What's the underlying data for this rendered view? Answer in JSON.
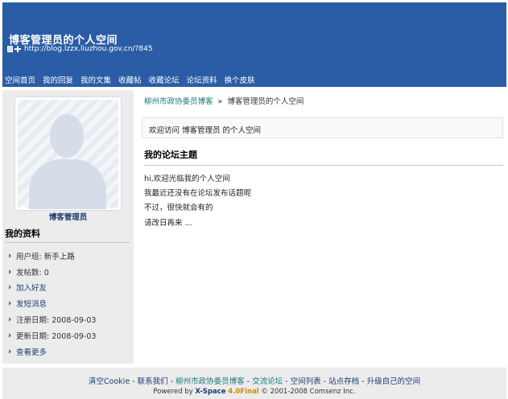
{
  "header": {
    "title": "博客管理员的个人空间",
    "url": "http://blog.lzzx.liuzhou.gov.cn/?845"
  },
  "nav": {
    "items": [
      "空间首页",
      "我的回复",
      "我的文集",
      "收藏帖",
      "收藏论坛",
      "论坛资料",
      "换个皮肤"
    ]
  },
  "sidebar": {
    "name": "博客管理员",
    "heading": "我的资料",
    "items": [
      {
        "label": "用户组: 新手上路"
      },
      {
        "label": "发帖数: 0"
      },
      {
        "label": "加入好友"
      },
      {
        "label": "发短消息"
      },
      {
        "label": "注册日期: 2008-09-03"
      },
      {
        "label": "更新日期: 2008-09-03"
      },
      {
        "label": "查看更多"
      }
    ]
  },
  "main": {
    "breadcrumb_link": "柳州市政协委员博客",
    "breadcrumb_sep": "»",
    "breadcrumb_current": "博客管理员的个人空间",
    "welcome": "欢迎访问 博客管理员 的个人空间",
    "forum_heading": "我的论坛主题",
    "forum_lines": [
      "hi,欢迎光临我的个人空间",
      "我最近还没有在论坛发布话题呢",
      "不过，很快就会有的",
      "请改日再来  ..."
    ]
  },
  "footer": {
    "links": [
      "清空Cookie",
      "联系我们",
      "柳州市政协委员博客",
      "交流论坛",
      "空间列表",
      "站点存档",
      "升级自己的空间"
    ],
    "sep": " - ",
    "powered_prefix": "Powered by ",
    "powered_brand": "X-Space",
    "powered_version": "4.0Final",
    "powered_suffix": " © 2001-2008 Comsenz Inc."
  }
}
